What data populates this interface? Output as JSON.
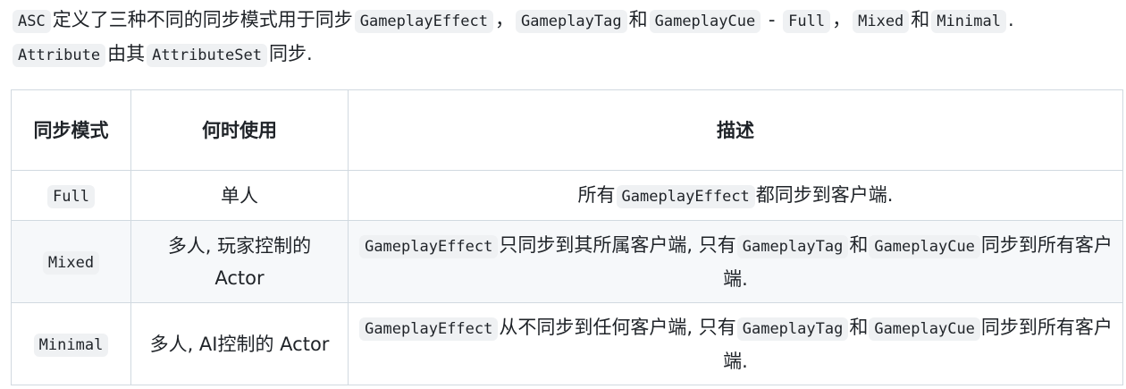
{
  "intro": {
    "t1": "ASC",
    "t2": "定义了三种不同的同步模式用于同步",
    "t3": "GameplayEffect",
    "t4": "，",
    "t5": "GameplayTag",
    "t6": "和",
    "t7": "GameplayCue",
    "t8": "-",
    "t9": "Full",
    "t10": "，",
    "t11": "Mixed",
    "t12": "和",
    "t13": "Minimal",
    "t14": ".",
    "t15": "Attribute",
    "t16": "由其",
    "t17": "AttributeSet",
    "t18": "同步."
  },
  "table": {
    "headers": {
      "mode": "同步模式",
      "when": "何时使用",
      "desc": "描述"
    },
    "rows": [
      {
        "mode": "Full",
        "when": "单人",
        "desc": {
          "p1": "所有",
          "c1": "GameplayEffect",
          "p2": "都同步到客户端."
        }
      },
      {
        "mode": "Mixed",
        "when": "多人, 玩家控制的 Actor",
        "desc": {
          "c1": "GameplayEffect",
          "p1": "只同步到其所属客户端, 只有",
          "c2": "GameplayTag",
          "p2": "和",
          "c3": "GameplayCue",
          "p3": "同步到所有客户端."
        }
      },
      {
        "mode": "Minimal",
        "when": "多人, AI控制的 Actor",
        "desc": {
          "c1": "GameplayEffect",
          "p1": "从不同步到任何客户端, 只有",
          "c2": "GameplayTag",
          "p2": "和",
          "c3": "GameplayCue",
          "p3": "同步到所有客户端."
        }
      }
    ]
  }
}
